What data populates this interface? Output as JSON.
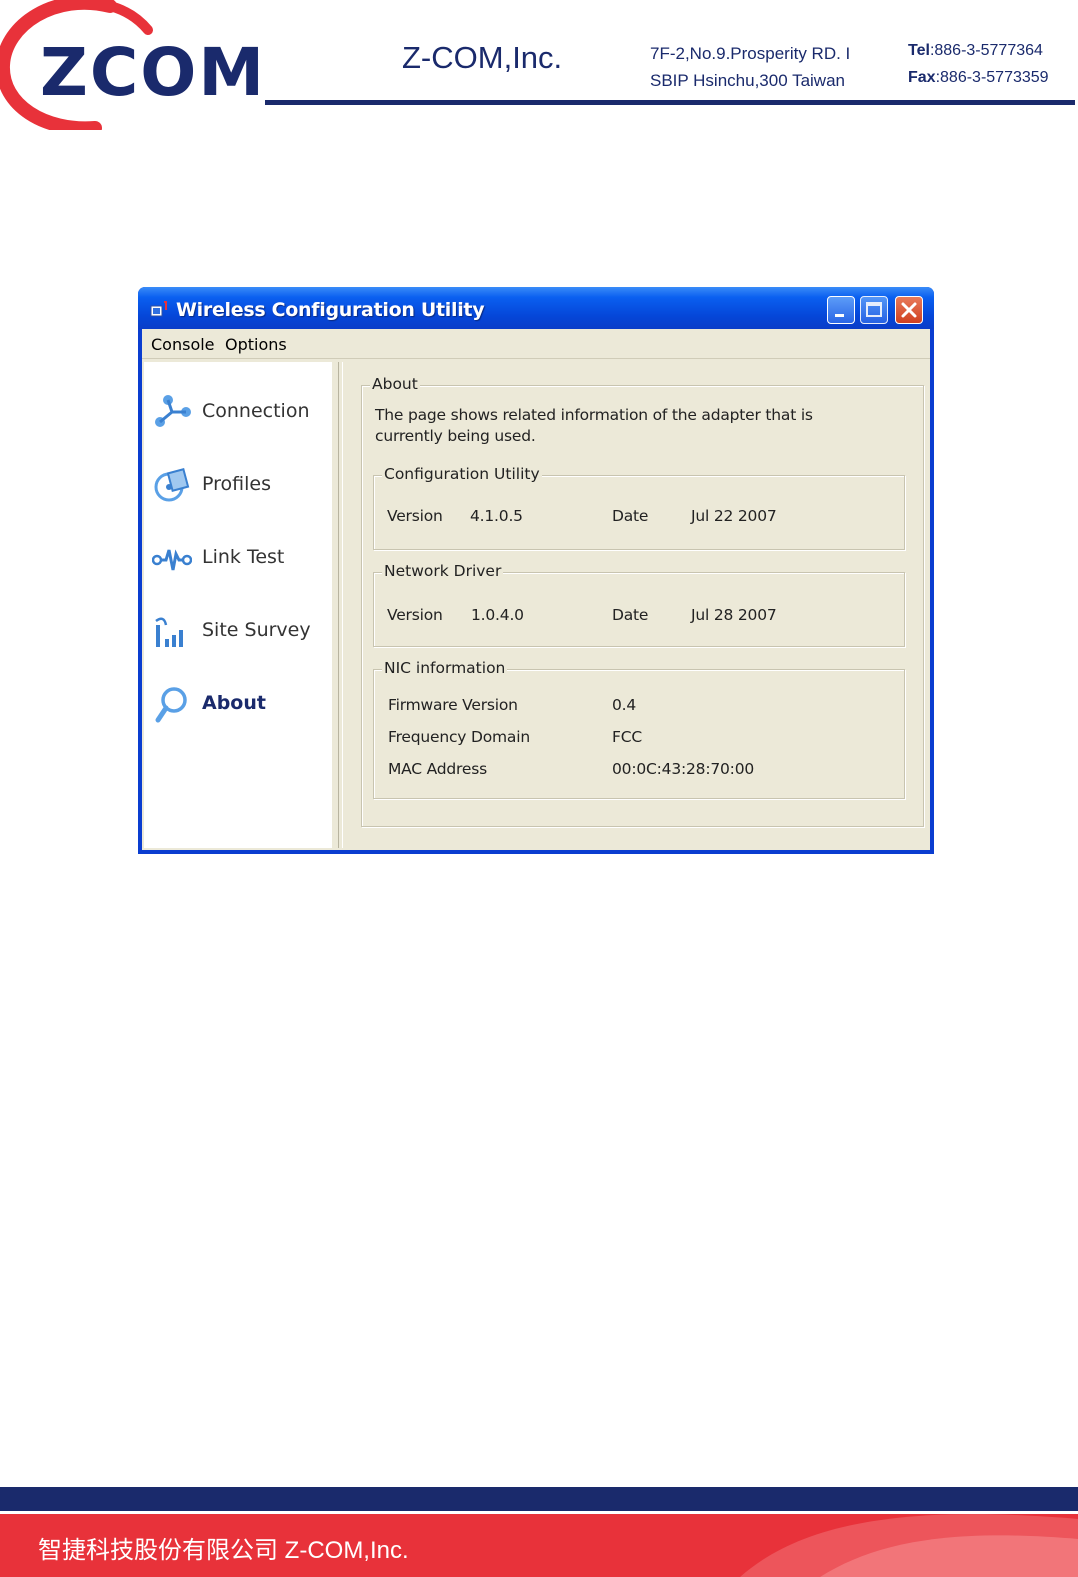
{
  "letterhead": {
    "brand_logo_text": "ZCOM",
    "company": "Z-COM,Inc.",
    "address_line1": "7F-2,No.9.Prosperity RD. I",
    "address_line2": "SBIP Hsinchu,300 Taiwan",
    "tel_label": "Tel",
    "tel_value": ":886-3-5777364",
    "fax_label": "Fax",
    "fax_value": ":886-3-5773359"
  },
  "footer": {
    "text": "智捷科技股份有限公司   Z-COM,Inc."
  },
  "window": {
    "title": "Wireless Configuration Utility",
    "menu": [
      {
        "label": "Console"
      },
      {
        "label": "Options"
      }
    ],
    "nav": [
      {
        "label": "Connection",
        "icon": "connection-icon"
      },
      {
        "label": "Profiles",
        "icon": "profiles-icon"
      },
      {
        "label": "Link Test",
        "icon": "link-test-icon"
      },
      {
        "label": "Site Survey",
        "icon": "site-survey-icon"
      },
      {
        "label": "About",
        "icon": "about-icon",
        "active": true
      }
    ],
    "about": {
      "title": "About",
      "desc_line1": "The page shows related information of the adapter that is",
      "desc_line2": "currently being  used.",
      "config_utility": {
        "title": "Configuration Utility",
        "version_label": "Version",
        "version": "4.1.0.5",
        "date_label": "Date",
        "date": "Jul 22 2007"
      },
      "network_driver": {
        "title": "Network Driver",
        "version_label": "Version",
        "version": "1.0.4.0",
        "date_label": "Date",
        "date": "Jul 28 2007"
      },
      "nic": {
        "title": "NIC information",
        "rows": [
          {
            "label": "Firmware Version",
            "value": "0.4"
          },
          {
            "label": "Frequency Domain",
            "value": "FCC"
          },
          {
            "label": "MAC Address",
            "value": "00:0C:43:28:70:00"
          }
        ]
      }
    }
  },
  "colors": {
    "brand_navy": "#1a2a6c",
    "brand_red": "#e8323a",
    "xp_blue": "#0a3dd0",
    "window_bg": "#ece9d8"
  }
}
